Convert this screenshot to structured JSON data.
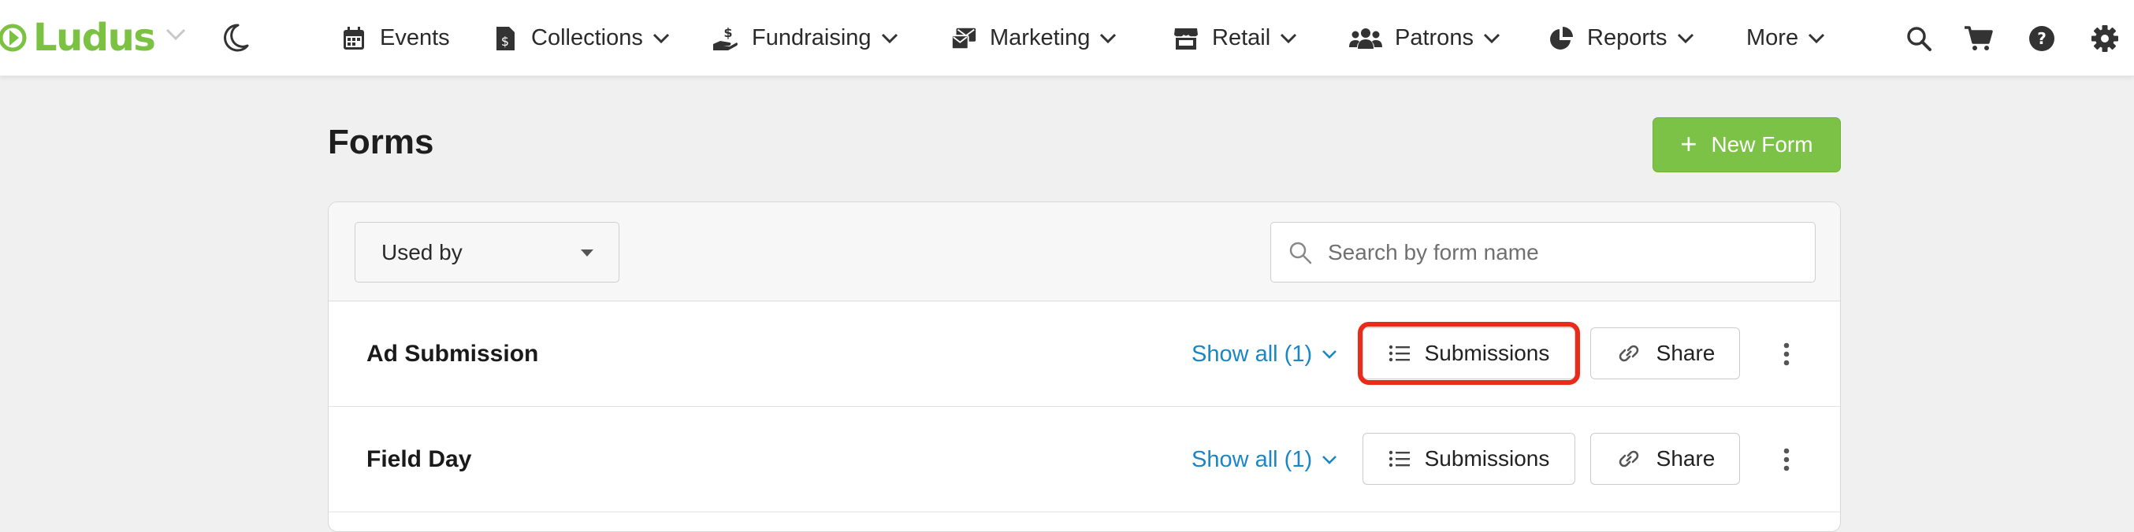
{
  "brand": {
    "name": "Ludus",
    "color": "#7bc142"
  },
  "nav": {
    "items": [
      {
        "label": "Events",
        "icon": "calendar-icon"
      },
      {
        "label": "Collections",
        "icon": "collections-icon"
      },
      {
        "label": "Fundraising",
        "icon": "fundraising-icon"
      },
      {
        "label": "Marketing",
        "icon": "marketing-icon"
      },
      {
        "label": "Retail",
        "icon": "store-icon"
      },
      {
        "label": "Patrons",
        "icon": "users-icon"
      },
      {
        "label": "Reports",
        "icon": "pie-chart-icon"
      },
      {
        "label": "More",
        "icon": ""
      }
    ],
    "right_icons": [
      "search-icon",
      "cart-icon",
      "help-icon",
      "gear-icon"
    ]
  },
  "page": {
    "title": "Forms",
    "new_form_label": "New Form",
    "accent": "#7cc246"
  },
  "filters": {
    "used_by_label": "Used by",
    "search_placeholder": "Search by form name"
  },
  "rows": [
    {
      "name": "Ad Submission",
      "show_all": "Show all (1)",
      "submissions_label": "Submissions",
      "share_label": "Share",
      "highlighted": true
    },
    {
      "name": "Field Day",
      "show_all": "Show all (1)",
      "submissions_label": "Submissions",
      "share_label": "Share",
      "highlighted": false
    }
  ],
  "colors": {
    "link": "#1a86c5",
    "highlight": "#ea2b1a"
  }
}
